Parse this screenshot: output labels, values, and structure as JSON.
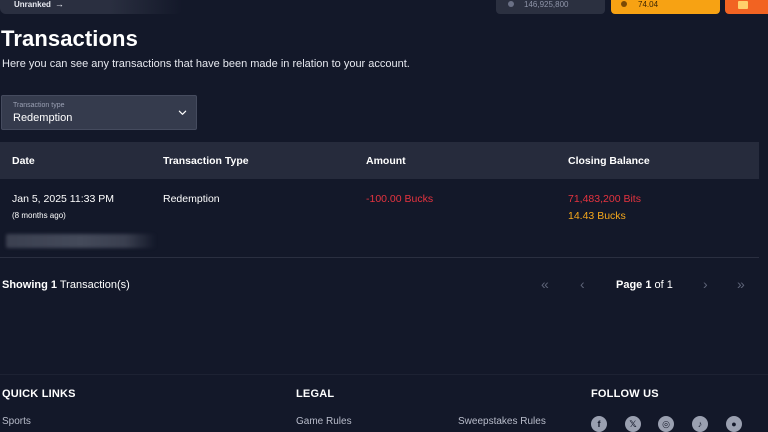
{
  "header": {
    "rank_label": "Unranked",
    "bits_balance": "146,925,800",
    "bucks_balance": "74.04"
  },
  "page": {
    "title": "Transactions",
    "subtitle": "Here you can see any transactions that have been made in relation to your account."
  },
  "filter": {
    "label": "Transaction type",
    "value": "Redemption"
  },
  "table": {
    "columns": [
      "Date",
      "Transaction Type",
      "Amount",
      "Closing Balance"
    ],
    "rows": [
      {
        "date": "Jan 5, 2025 11:33 PM",
        "relative": "(8 months ago)",
        "type": "Redemption",
        "amount": "-100.00 Bucks",
        "closing_bits": "71,483,200 Bits",
        "closing_bucks": "14.43 Bucks"
      }
    ]
  },
  "pagination": {
    "showing_prefix": "Showing",
    "count": "1",
    "showing_suffix": "Transaction(s)",
    "page_prefix": "Page",
    "current_page": "1",
    "of_label": "of",
    "total_pages": "1"
  },
  "footer": {
    "quick_links_title": "QUICK LINKS",
    "legal_title": "LEGAL",
    "follow_title": "FOLLOW US",
    "quick_links": [
      "Sports"
    ],
    "legal_links": [
      "Game Rules",
      "Sweepstakes Rules"
    ],
    "social_icons": [
      "facebook-icon",
      "x-icon",
      "instagram-icon",
      "tiktok-icon",
      "reddit-icon"
    ]
  },
  "colors": {
    "background": "#131829",
    "negative": "#e5333f",
    "bucks": "#f6a81b"
  }
}
